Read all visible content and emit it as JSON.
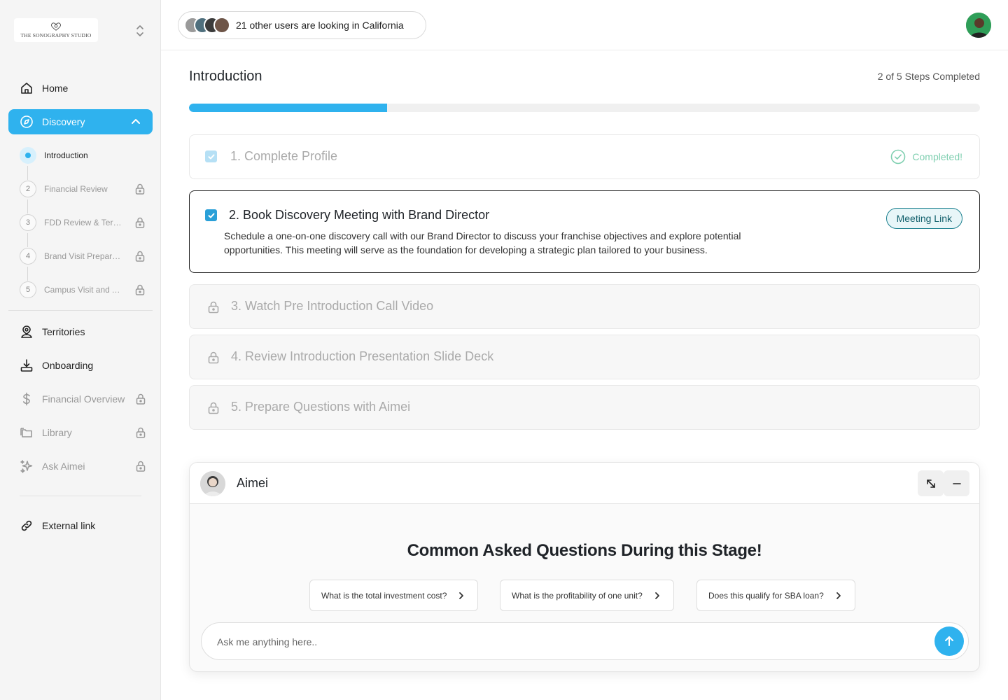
{
  "brand": {
    "name": "THE SONOGRAPHY STUDIO"
  },
  "sidebar": {
    "items": [
      {
        "label": "Home",
        "icon": "home-icon"
      },
      {
        "label": "Discovery",
        "icon": "compass-icon"
      },
      {
        "label": "Territories",
        "icon": "user-location-icon"
      },
      {
        "label": "Onboarding",
        "icon": "download-tray-icon"
      },
      {
        "label": "Financial Overview",
        "icon": "dollar-icon",
        "locked": true
      },
      {
        "label": "Library",
        "icon": "folders-icon",
        "locked": true
      },
      {
        "label": "Ask Aimei",
        "icon": "sparkle-icon",
        "locked": true
      },
      {
        "label": "External link",
        "icon": "link-icon"
      }
    ],
    "discovery_steps": [
      {
        "num": "",
        "label": "Introduction",
        "current": true
      },
      {
        "num": "2",
        "label": "Financial Review",
        "locked": true
      },
      {
        "num": "3",
        "label": "FDD Review & Territory Selection",
        "locked": true
      },
      {
        "num": "4",
        "label": "Brand Visit Preparation",
        "locked": true
      },
      {
        "num": "5",
        "label": "Campus Visit and Approval",
        "locked": true
      }
    ]
  },
  "header": {
    "viewers_text": "21 other users are  looking in California"
  },
  "main": {
    "title": "Introduction",
    "steps_completed": "2  of  5 Steps Completed",
    "progress_fraction": 0.25,
    "steps": [
      {
        "title": "1. Complete Profile",
        "status": "Completed!"
      },
      {
        "title": "2. Book Discovery Meeting with Brand Director",
        "description": "Schedule a one-on-one discovery call with our Brand Director to discuss your franchise objectives and explore potential opportunities. This meeting will serve as the foundation for developing a strategic plan tailored to your business.",
        "action": "Meeting Link"
      },
      {
        "title": "3. Watch Pre Introduction Call Video"
      },
      {
        "title": "4. Review Introduction Presentation Slide Deck"
      },
      {
        "title": "5. Prepare Questions with Aimei"
      }
    ]
  },
  "chat": {
    "bot_name": "Aimei",
    "title": "Common Asked Questions During this Stage!",
    "suggestions": [
      "What is the total investment cost?",
      "What is the profitability of one unit?",
      "Does this qualify for SBA loan?"
    ],
    "input_placeholder": "Ask me anything here.."
  },
  "colors": {
    "accent": "#2fb2ee",
    "completed": "#7fcfb0",
    "meeting_button": "#12606c"
  }
}
